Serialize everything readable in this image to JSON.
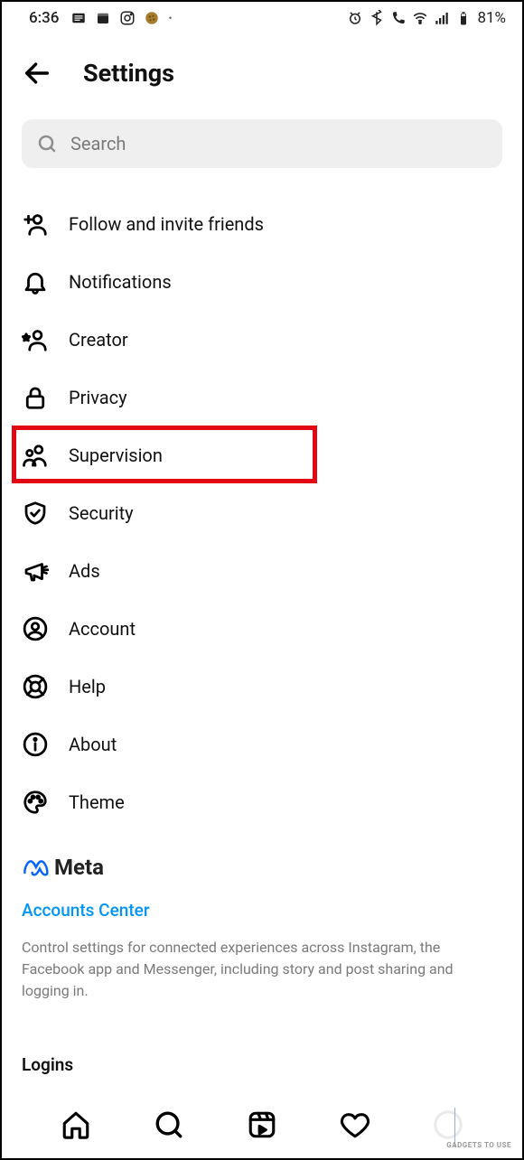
{
  "status": {
    "time": "6:36",
    "battery": "81%"
  },
  "header": {
    "title": "Settings"
  },
  "search": {
    "placeholder": "Search"
  },
  "menu": {
    "items": [
      {
        "label": "Follow and invite friends"
      },
      {
        "label": "Notifications"
      },
      {
        "label": "Creator"
      },
      {
        "label": "Privacy"
      },
      {
        "label": "Supervision"
      },
      {
        "label": "Security"
      },
      {
        "label": "Ads"
      },
      {
        "label": "Account"
      },
      {
        "label": "Help"
      },
      {
        "label": "About"
      },
      {
        "label": "Theme"
      }
    ]
  },
  "meta": {
    "brand": "Meta",
    "accounts_link": "Accounts Center",
    "description": "Control settings for connected experiences across Instagram, the Facebook app and Messenger, including story and post sharing and logging in.",
    "logins_title": "Logins"
  },
  "watermark": "GADGETS TO USE"
}
